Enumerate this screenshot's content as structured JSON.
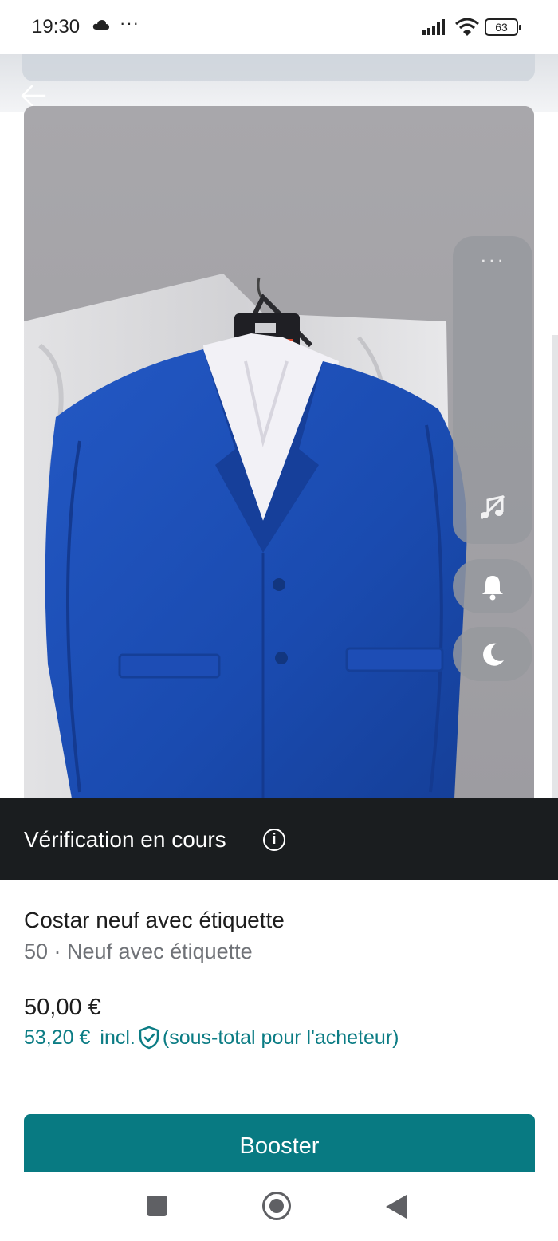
{
  "status_bar": {
    "time": "19:30",
    "overflow": "···",
    "battery": "63",
    "icons": [
      "cloud-icon",
      "signal-icon",
      "wifi-icon",
      "battery-icon"
    ]
  },
  "header": {
    "back_icon": "arrow-left-icon"
  },
  "photo": {
    "description_icon": "blue-suit-jacket-photo",
    "pages": 3,
    "active_page": 1
  },
  "floating_panel": {
    "more": "···",
    "icons": [
      "music-note-off-icon",
      "bell-icon",
      "moon-icon"
    ]
  },
  "verification": {
    "text": "Vérification en cours",
    "info_glyph": "i"
  },
  "item": {
    "title": "Costar neuf avec étiquette",
    "subtitle": "50 · Neuf avec étiquette",
    "price": "50,00 €",
    "buyer_total": "53,20 €",
    "incl": "incl.",
    "buyer_note": "(sous-total pour l'acheteur)"
  },
  "actions": {
    "booster_label": "Booster"
  },
  "colors": {
    "accent": "#087a82",
    "banner": "#1a1d1f",
    "jacket": "#1d4fb8"
  }
}
